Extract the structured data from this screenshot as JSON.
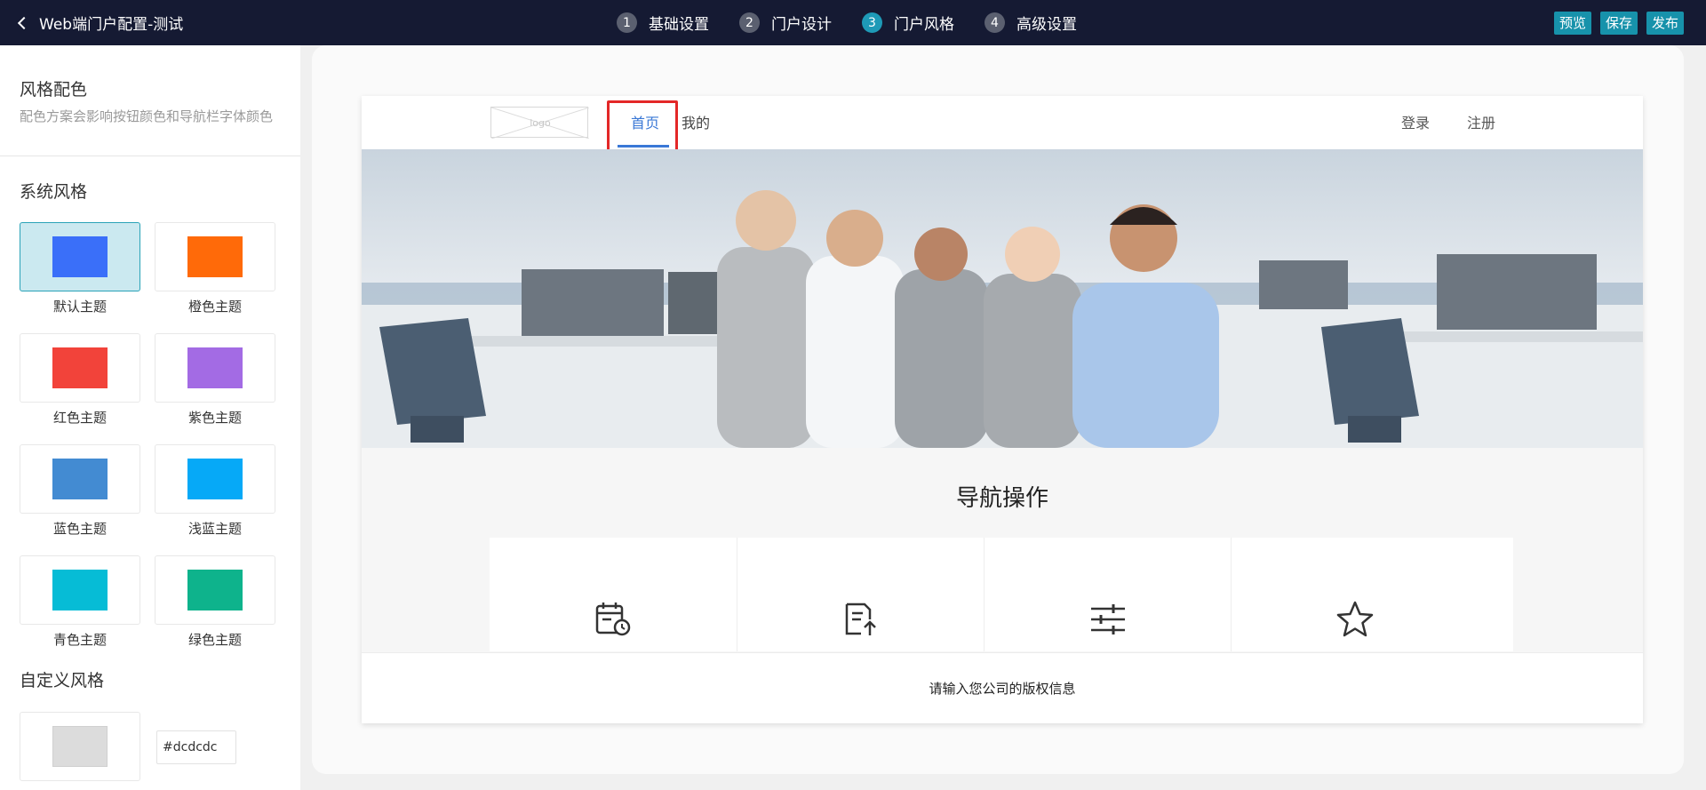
{
  "header": {
    "back_title": "Web端门户配置-测试",
    "steps": [
      {
        "num": "1",
        "label": "基础设置"
      },
      {
        "num": "2",
        "label": "门户设计"
      },
      {
        "num": "3",
        "label": "门户风格"
      },
      {
        "num": "4",
        "label": "高级设置"
      }
    ],
    "active_step": 3,
    "actions": {
      "preview": "预览",
      "save": "保存",
      "publish": "发布"
    }
  },
  "sidebar": {
    "color_scheme_title": "风格配色",
    "color_scheme_desc": "配色方案会影响按钮颜色和导航栏字体颜色",
    "system_style_title": "系统风格",
    "themes": [
      {
        "label": "默认主题",
        "color": "#3a6ff9",
        "selected": true
      },
      {
        "label": "橙色主题",
        "color": "#ff6a09"
      },
      {
        "label": "红色主题",
        "color": "#f2433a"
      },
      {
        "label": "紫色主题",
        "color": "#a36be4"
      },
      {
        "label": "蓝色主题",
        "color": "#438bd2"
      },
      {
        "label": "浅蓝主题",
        "color": "#06a9f7"
      },
      {
        "label": "青色主题",
        "color": "#06bcd6"
      },
      {
        "label": "绿色主题",
        "color": "#0eb38c"
      }
    ],
    "custom_style_title": "自定义风格",
    "custom_color": "#dcdcdc",
    "custom_hex_value": "#dcdcdc"
  },
  "preview": {
    "logo_text": "logo",
    "nav": {
      "home": "首页",
      "mine": "我的",
      "login": "登录",
      "register": "注册"
    },
    "section_title": "导航操作",
    "operations": [
      {
        "icon": "calendar-clock-icon"
      },
      {
        "icon": "document-upload-icon"
      },
      {
        "icon": "sliders-icon"
      },
      {
        "icon": "star-icon"
      }
    ],
    "footer": "请输入您公司的版权信息"
  },
  "colors": {
    "topbar": "#151a33",
    "accent": "#1792ab",
    "nav_active": "#3a78d6",
    "highlight": "#e32727"
  }
}
